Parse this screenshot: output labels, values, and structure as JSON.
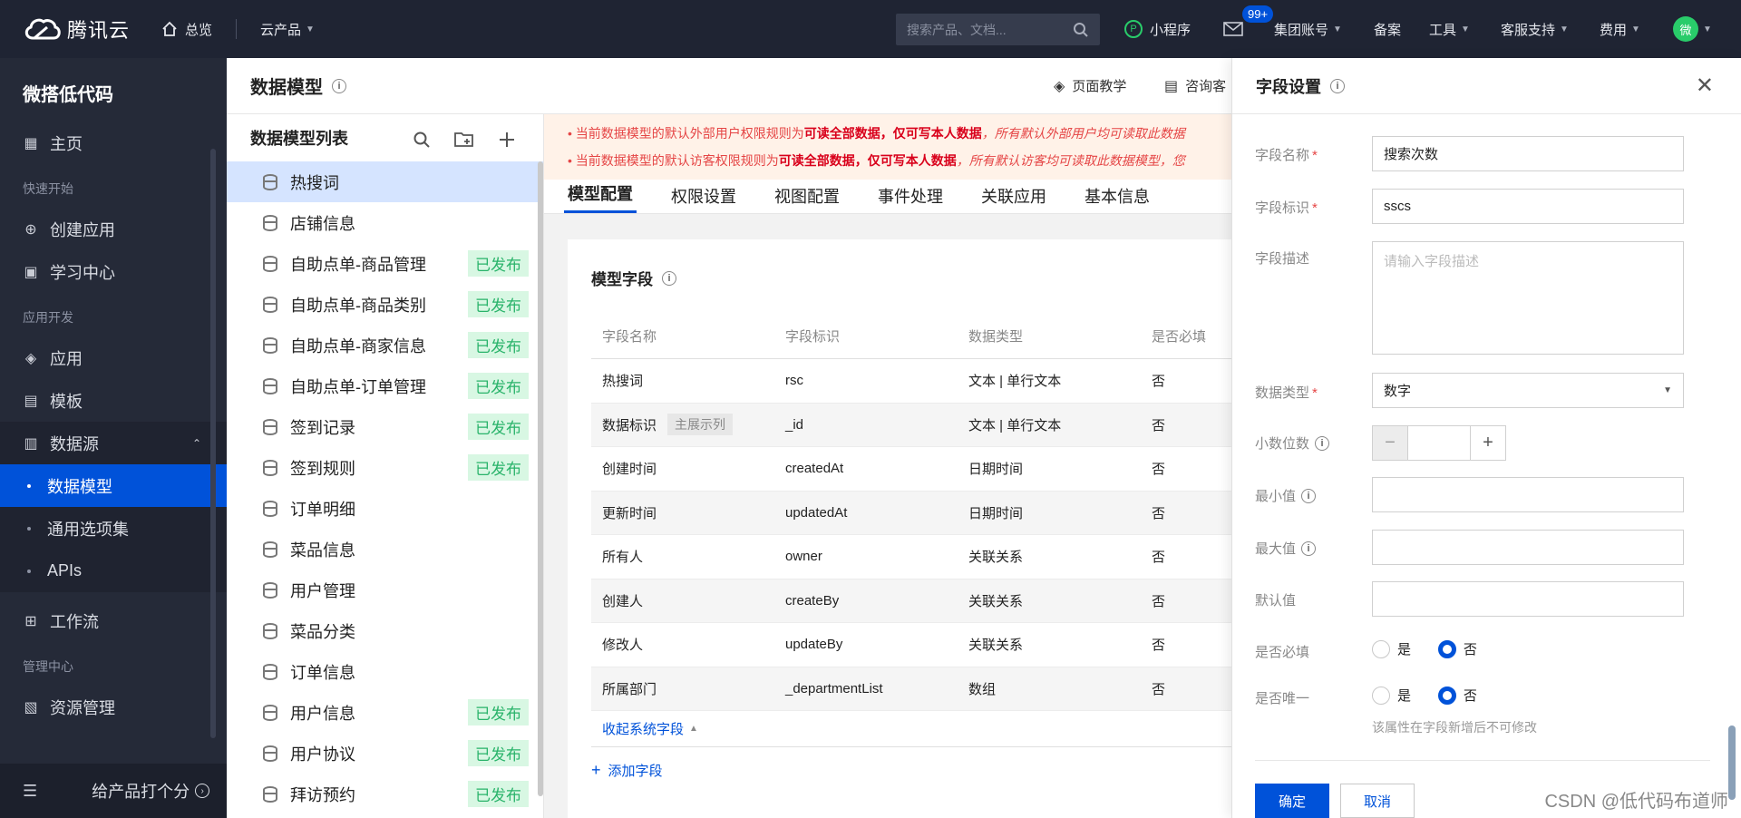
{
  "topbar": {
    "brand": "腾讯云",
    "overview": "总览",
    "cloud_products": "云产品",
    "search_placeholder": "搜索产品、文档...",
    "miniprogram": "小程序",
    "badge": "99+",
    "group_account": "集团账号",
    "filing": "备案",
    "tools": "工具",
    "support": "客服支持",
    "billing": "费用",
    "avatar": "微"
  },
  "sidebar": {
    "product": "微搭低代码",
    "home": "主页",
    "section_quickstart": "快速开始",
    "create_app": "创建应用",
    "learn_center": "学习中心",
    "section_appdev": "应用开发",
    "apps": "应用",
    "templates": "模板",
    "datasource": "数据源",
    "sub_items": [
      "数据模型",
      "通用选项集",
      "APIs"
    ],
    "workflow": "工作流",
    "section_manage": "管理中心",
    "resource_mgmt": "资源管理",
    "rate_product": "给产品打个分"
  },
  "header": {
    "title": "数据模型",
    "page_tutorial": "页面教学",
    "consult": "咨询客"
  },
  "model_list": {
    "title": "数据模型列表",
    "published_label": "已发布",
    "items": [
      {
        "name": "热搜词",
        "published": false
      },
      {
        "name": "店铺信息",
        "published": false
      },
      {
        "name": "自助点单-商品管理",
        "published": true
      },
      {
        "name": "自助点单-商品类别",
        "published": true
      },
      {
        "name": "自助点单-商家信息",
        "published": true
      },
      {
        "name": "自助点单-订单管理",
        "published": true
      },
      {
        "name": "签到记录",
        "published": true
      },
      {
        "name": "签到规则",
        "published": true
      },
      {
        "name": "订单明细",
        "published": false
      },
      {
        "name": "菜品信息",
        "published": false
      },
      {
        "name": "用户管理",
        "published": false
      },
      {
        "name": "菜品分类",
        "published": false
      },
      {
        "name": "订单信息",
        "published": false
      },
      {
        "name": "用户信息",
        "published": true
      },
      {
        "name": "用户协议",
        "published": true
      },
      {
        "name": "拜访预约",
        "published": true
      }
    ]
  },
  "notice": {
    "line1_prefix": "当前数据模型的默认外部用户权限规则为",
    "line1_bold": "可读全部数据，仅可写本人数据",
    "line1_italic": "，所有默认外部用户均可读取此数据",
    "line2_prefix": "当前数据模型的默认访客权限规则为",
    "line2_bold": "可读全部数据，仅可写本人数据",
    "line2_italic": "，所有默认访客均可读取此数据模型，您"
  },
  "tabs": [
    "模型配置",
    "权限设置",
    "视图配置",
    "事件处理",
    "关联应用",
    "基本信息"
  ],
  "fields_card": {
    "title": "模型字段",
    "columns": [
      "字段名称",
      "字段标识",
      "数据类型",
      "是否必填"
    ],
    "rows": [
      {
        "name": "热搜词",
        "tag": "",
        "key": "rsc",
        "type": "文本 | 单行文本",
        "required": "否"
      },
      {
        "name": "数据标识",
        "tag": "主展示列",
        "key": "_id",
        "type": "文本 | 单行文本",
        "required": "否"
      },
      {
        "name": "创建时间",
        "tag": "",
        "key": "createdAt",
        "type": "日期时间",
        "required": "否"
      },
      {
        "name": "更新时间",
        "tag": "",
        "key": "updatedAt",
        "type": "日期时间",
        "required": "否"
      },
      {
        "name": "所有人",
        "tag": "",
        "key": "owner",
        "type": "关联关系",
        "required": "否"
      },
      {
        "name": "创建人",
        "tag": "",
        "key": "createBy",
        "type": "关联关系",
        "required": "否"
      },
      {
        "name": "修改人",
        "tag": "",
        "key": "updateBy",
        "type": "关联关系",
        "required": "否"
      },
      {
        "name": "所属部门",
        "tag": "",
        "key": "_departmentList",
        "type": "数组",
        "required": "否"
      }
    ],
    "collapse_system": "收起系统字段",
    "add_field": "添加字段"
  },
  "drawer": {
    "title": "字段设置",
    "field_name_label": "字段名称",
    "field_name_value": "搜索次数",
    "field_key_label": "字段标识",
    "field_key_value": "sscs",
    "field_desc_label": "字段描述",
    "field_desc_placeholder": "请输入字段描述",
    "data_type_label": "数据类型",
    "data_type_value": "数字",
    "decimals_label": "小数位数",
    "min_label": "最小值",
    "max_label": "最大值",
    "default_label": "默认值",
    "required_label": "是否必填",
    "unique_label": "是否唯一",
    "yes": "是",
    "no": "否",
    "unique_hint": "该属性在字段新增后不可修改",
    "confirm": "确定",
    "cancel": "取消"
  },
  "watermark": "CSDN @低代码布道师"
}
